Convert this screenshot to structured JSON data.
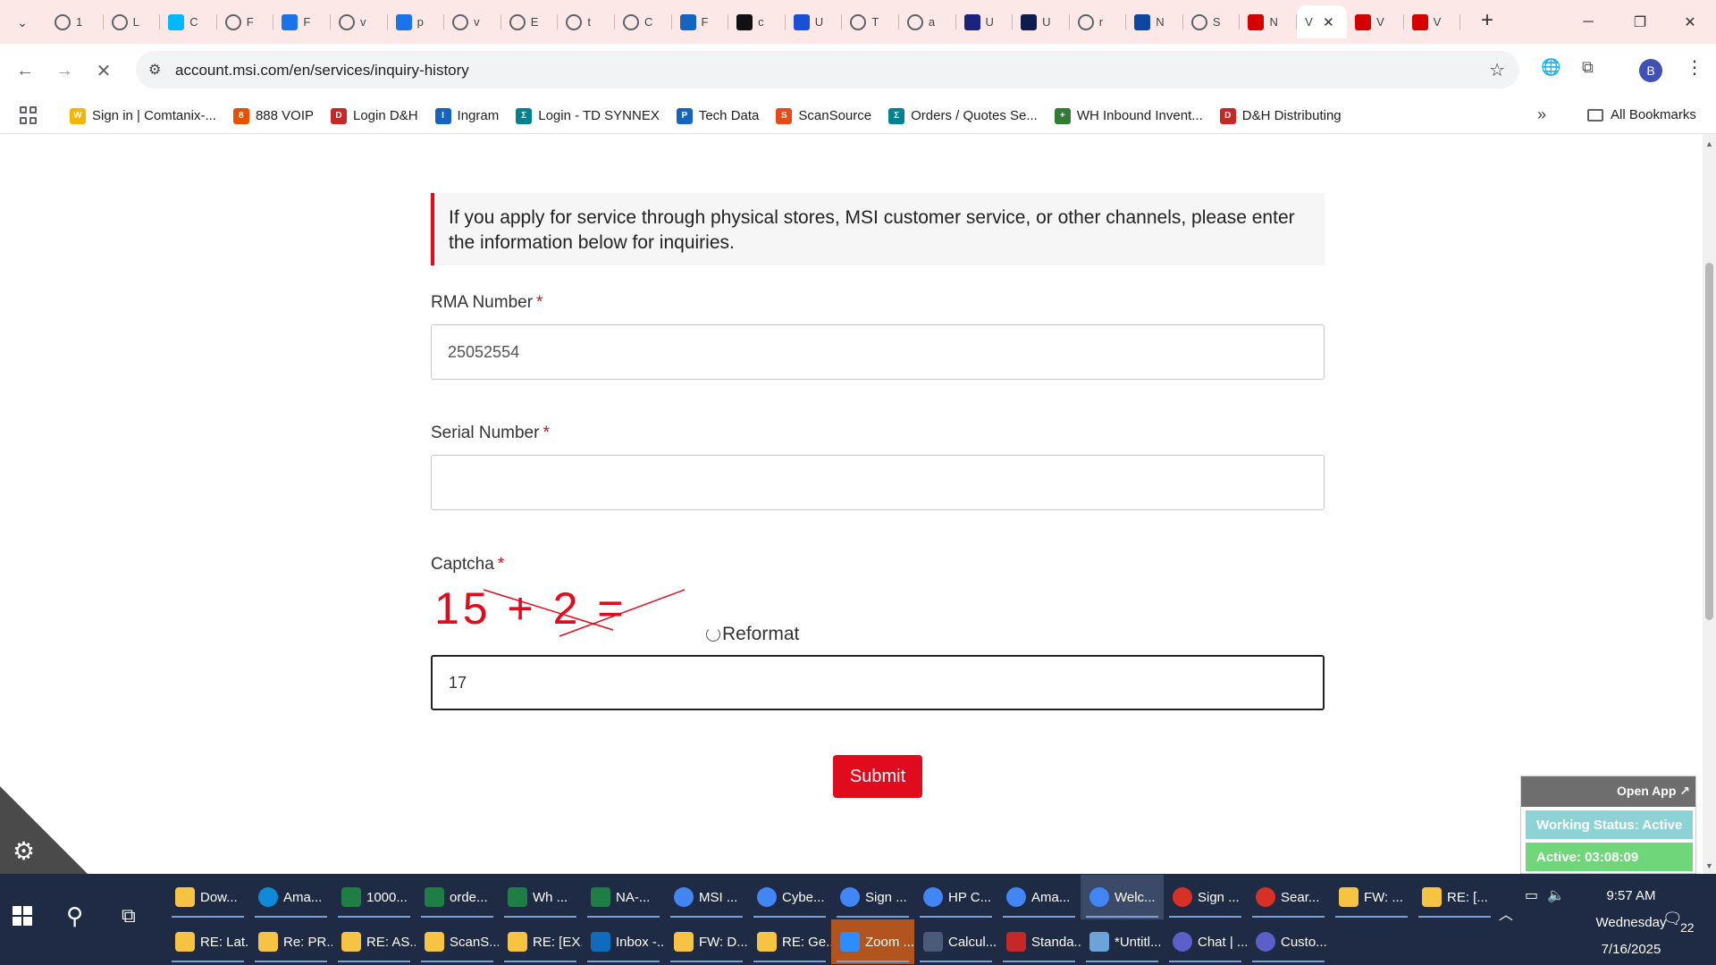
{
  "browser": {
    "tabs": [
      {
        "label": "1",
        "icon": "globe",
        "color": "#5f6368"
      },
      {
        "label": "L",
        "icon": "globe",
        "color": "#5f6368"
      },
      {
        "label": "C",
        "icon": "logi",
        "color": "#00b8fc"
      },
      {
        "label": "F",
        "icon": "globe",
        "color": "#5f6368"
      },
      {
        "label": "F",
        "icon": "arrow",
        "color": "#1a73e8"
      },
      {
        "label": "v",
        "icon": "globe",
        "color": "#5f6368"
      },
      {
        "label": "p",
        "icon": "hand",
        "color": "#1a73e8"
      },
      {
        "label": "v",
        "icon": "globe",
        "color": "#5f6368"
      },
      {
        "label": "E",
        "icon": "globe",
        "color": "#5f6368"
      },
      {
        "label": "t",
        "icon": "globe",
        "color": "#5f6368"
      },
      {
        "label": "C",
        "icon": "globe",
        "color": "#5f6368"
      },
      {
        "label": "F",
        "icon": "car",
        "color": "#1565c0"
      },
      {
        "label": "c",
        "icon": "dark",
        "color": "#111111"
      },
      {
        "label": "U",
        "icon": "u",
        "color": "#1a4fd6"
      },
      {
        "label": "T",
        "icon": "globe",
        "color": "#5f6368"
      },
      {
        "label": "a",
        "icon": "globe",
        "color": "#5f6368"
      },
      {
        "label": "U",
        "icon": "box",
        "color": "#1a237e"
      },
      {
        "label": "U",
        "icon": "check",
        "color": "#0d1b4f"
      },
      {
        "label": "r",
        "icon": "globe",
        "color": "#5f6368"
      },
      {
        "label": "N",
        "icon": "etn",
        "color": "#0d47a1"
      },
      {
        "label": "S",
        "icon": "globe",
        "color": "#5f6368"
      },
      {
        "label": "N",
        "icon": "shield",
        "color": "#d50000"
      }
    ],
    "active_tab": {
      "label": "V",
      "close": "✕"
    },
    "tabs_after": [
      {
        "label": "V",
        "icon": "shield",
        "color": "#d50000"
      },
      {
        "label": "V",
        "icon": "shield",
        "color": "#d50000"
      }
    ],
    "url": "account.msi.com/en/services/inquiry-history",
    "profile_initial": "B",
    "bookmarks": [
      {
        "label": "Sign in | Comtanix-...",
        "icon_text": "W",
        "color": "#f7b500"
      },
      {
        "label": "888 VOIP",
        "icon_text": "8",
        "color": "#e65100"
      },
      {
        "label": "Login D&H",
        "icon_text": "D",
        "color": "#c62828"
      },
      {
        "label": "Ingram",
        "icon_text": "I",
        "color": "#1565c0"
      },
      {
        "label": "Login - TD SYNNEX",
        "icon_text": "Σ",
        "color": "#00838f"
      },
      {
        "label": "Tech Data",
        "icon_text": "P",
        "color": "#1565c0"
      },
      {
        "label": "ScanSource",
        "icon_text": "S",
        "color": "#e64a19"
      },
      {
        "label": "Orders / Quotes Se...",
        "icon_text": "Σ",
        "color": "#00838f"
      },
      {
        "label": "WH Inbound Invent...",
        "icon_text": "+",
        "color": "#2e7d32"
      },
      {
        "label": "D&H Distributing",
        "icon_text": "D",
        "color": "#c62828"
      }
    ],
    "more_bookmarks": "»",
    "all_bookmarks": "All Bookmarks"
  },
  "page": {
    "notice": "If you apply for service through physical stores, MSI customer service, or other channels, please enter the information below for inquiries.",
    "rma_label": "RMA Number",
    "rma_value": "25052554",
    "serial_label": "Serial Number",
    "serial_value": "",
    "captcha_label": "Captcha",
    "required_mark": "*",
    "captcha_text": "15 + 2 =",
    "reformat": "Reformat",
    "captcha_value": "17",
    "submit": "Submit",
    "accent_color": "#e00b1c"
  },
  "widget": {
    "open_app": "Open App ↗",
    "working_status": "Working Status: Active",
    "active_time": "Active: 03:08:09"
  },
  "taskbar": {
    "row1": [
      {
        "label": "Dow...",
        "icon": "folder",
        "color": "#f6c342"
      },
      {
        "label": "Ama...",
        "icon": "edge",
        "color": "#0f8ad8"
      },
      {
        "label": "1000...",
        "icon": "excel",
        "color": "#1e7e45"
      },
      {
        "label": "orde...",
        "icon": "excel",
        "color": "#1e7e45"
      },
      {
        "label": "Wh ...",
        "icon": "excel",
        "color": "#1e7e45"
      },
      {
        "label": "NA-...",
        "icon": "excel",
        "color": "#1e7e45"
      },
      {
        "label": "MSI ...",
        "icon": "chrome",
        "color": "#4285f4"
      },
      {
        "label": "Cybe...",
        "icon": "chrome",
        "color": "#4285f4"
      },
      {
        "label": "Sign ...",
        "icon": "chrome",
        "color": "#4285f4"
      },
      {
        "label": "HP C...",
        "icon": "chrome",
        "color": "#4285f4"
      },
      {
        "label": "Ama...",
        "icon": "chrome",
        "color": "#4285f4"
      },
      {
        "label": "Welc...",
        "icon": "chrome",
        "color": "#4285f4"
      },
      {
        "label": "Sign ...",
        "icon": "chrome",
        "color": "#d93025"
      },
      {
        "label": "Sear...",
        "icon": "chrome",
        "color": "#d93025"
      },
      {
        "label": "FW: ...",
        "icon": "mail",
        "color": "#f6c342"
      },
      {
        "label": "RE: [...",
        "icon": "mail",
        "color": "#f6c342"
      }
    ],
    "row2": [
      {
        "label": "RE: Lat...",
        "icon": "mail",
        "color": "#f6c342"
      },
      {
        "label": "Re: PR...",
        "icon": "mail",
        "color": "#f6c342"
      },
      {
        "label": "RE: AS...",
        "icon": "mail",
        "color": "#f6c342"
      },
      {
        "label": "ScanS...",
        "icon": "mail",
        "color": "#f6c342"
      },
      {
        "label": "RE: [EX...",
        "icon": "mail",
        "color": "#f6c342"
      },
      {
        "label": "Inbox -...",
        "icon": "outlook",
        "color": "#0f6cbd"
      },
      {
        "label": "FW: D...",
        "icon": "mail",
        "color": "#f6c342"
      },
      {
        "label": "RE: Ge...",
        "icon": "mail",
        "color": "#f6c342"
      },
      {
        "label": "Zoom ...",
        "icon": "zoom",
        "color": "#2d8cff"
      },
      {
        "label": "Calcul...",
        "icon": "calc",
        "color": "#4a5b7a"
      },
      {
        "label": "Standa...",
        "icon": "pdf",
        "color": "#c62828"
      },
      {
        "label": "*Untitl...",
        "icon": "paint",
        "color": "#6aa4d8"
      },
      {
        "label": "Chat | ...",
        "icon": "teams",
        "color": "#5b5fc7"
      },
      {
        "label": "Custo...",
        "icon": "teams",
        "color": "#5b5fc7"
      }
    ],
    "time": "9:57 AM",
    "day": "Wednesday",
    "date": "7/16/2025",
    "notifications": "22"
  }
}
